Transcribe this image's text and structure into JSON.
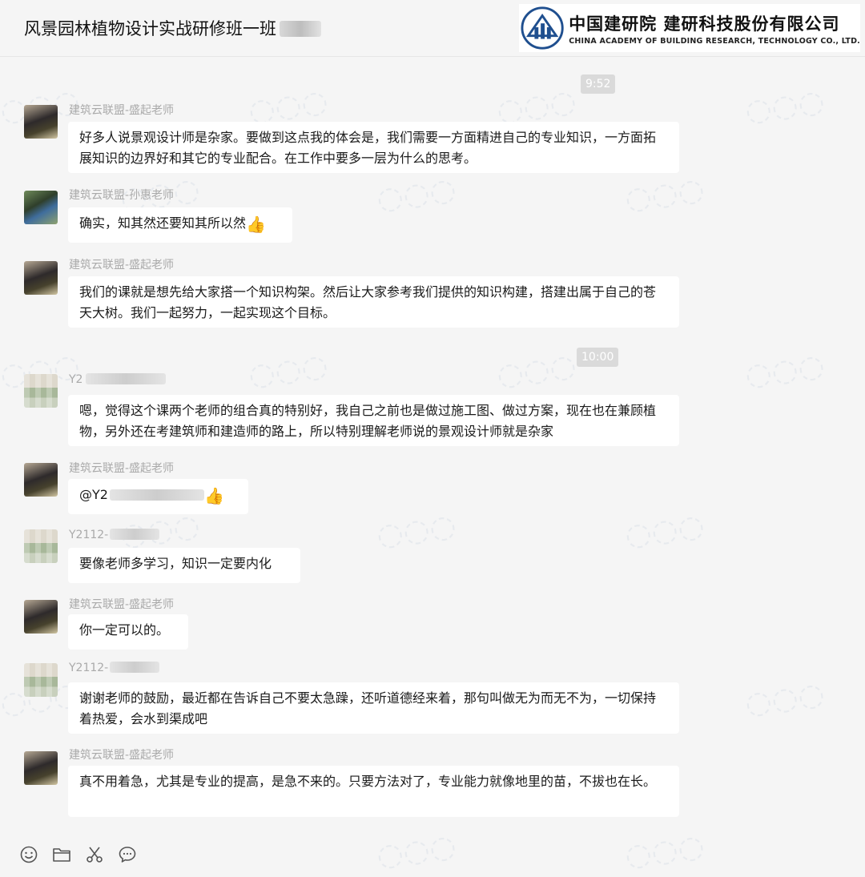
{
  "header": {
    "title": "风景园林植物设计实战研修班一班"
  },
  "logo": {
    "cn": "中国建研院 建研科技股份有限公司",
    "en": "CHINA ACADEMY OF BUILDING RESEARCH, TECHNOLOGY CO., LTD."
  },
  "times": [
    "9:52",
    "10:00"
  ],
  "messages": [
    {
      "sender": "建筑云联盟-盛起老师",
      "text": "好多人说景观设计师是杂家。要做到这点我的体会是，我们需要一方面精进自己的专业知识，一方面拓展知识的边界好和其它的专业配合。在工作中要多一层为什么的思考。"
    },
    {
      "sender": "建筑云联盟-孙惠老师",
      "text": "确实，知其然还要知其所以然"
    },
    {
      "sender": "建筑云联盟-盛起老师",
      "text": "我们的课就是想先给大家搭一个知识构架。然后让大家参考我们提供的知识构建，搭建出属于自己的苍天大树。我们一起努力，一起实现这个目标。"
    },
    {
      "sender": "Y2",
      "text": "嗯，觉得这个课两个老师的组合真的特别好，我自己之前也是做过施工图、做过方案，现在也在兼顾植物，另外还在考建筑师和建造师的路上，所以特别理解老师说的景观设计师就是杂家"
    },
    {
      "sender": "建筑云联盟-盛起老师",
      "text": "@Y2"
    },
    {
      "sender": "Y2112-",
      "text": "要像老师多学习，知识一定要内化"
    },
    {
      "sender": "建筑云联盟-盛起老师",
      "text": "你一定可以的。"
    },
    {
      "sender": "Y2112-",
      "text": "谢谢老师的鼓励，最近都在告诉自己不要太急躁，还听道德经来着，那句叫做无为而无不为，一切保持着热爱，会水到渠成吧"
    },
    {
      "sender": "建筑云联盟-盛起老师",
      "text": "真不用着急，尤其是专业的提高，是急不来的。只要方法对了，专业能力就像地里的苗，不拔也在长。"
    }
  ],
  "icons": {
    "thumb": "thumbs-up-emoji",
    "toolbar": [
      "smiley-icon",
      "folder-icon",
      "scissors-icon",
      "chat-bubble-icon"
    ]
  },
  "colors": {
    "background": "#f5f5f5",
    "bubble": "#ffffff",
    "sender": "#aaaaaa",
    "time_pill": "#dadada"
  }
}
